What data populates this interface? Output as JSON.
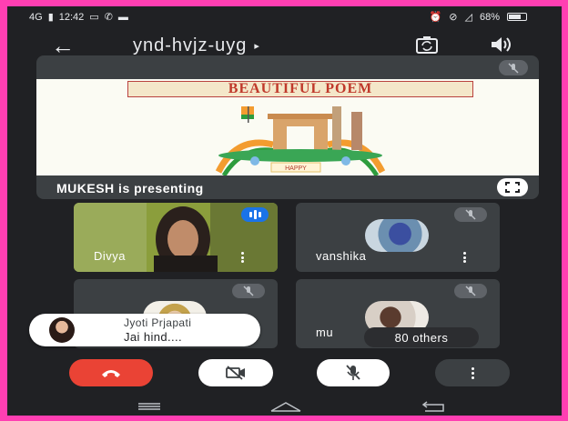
{
  "status_bar": {
    "signal": "4G",
    "time": "12:42",
    "battery_percent": "68%"
  },
  "app_bar": {
    "meeting_code": "ynd-hvjz-uyg",
    "caret": "▸"
  },
  "presentation": {
    "slide_title": "BEAUTIFUL POEM",
    "slide_badge": "HAPPY",
    "presenter_label": "MUKESH is presenting"
  },
  "participants": [
    {
      "name": "Divya",
      "speaking": true
    },
    {
      "name": "vanshika",
      "mic_muted": true
    },
    {
      "name": "",
      "mic_muted": true
    },
    {
      "name": "mu",
      "mic_muted": true
    }
  ],
  "chat_toast": {
    "sender": "Jyoti Prjapati",
    "message": "Jai hind...."
  },
  "others": {
    "label": "80 others"
  },
  "controls": {
    "end_call_icon": "phone-hangup-icon",
    "camera_icon": "video-off-icon",
    "mic_icon": "mic-off-icon",
    "more_icon": "more-vert-icon"
  },
  "colors": {
    "end_call": "#ea4335",
    "speaking": "#1a73e8",
    "tile_bg": "#3c4043",
    "screen_bg": "#202124",
    "frame": "#ff3fb2"
  }
}
